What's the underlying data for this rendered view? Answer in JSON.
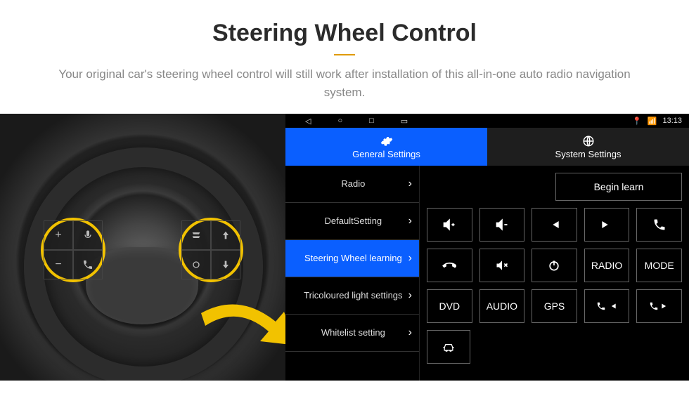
{
  "header": {
    "title": "Steering Wheel Control",
    "subtitle": "Your original car's steering wheel control will still work after installation of this all-in-one auto radio navigation system."
  },
  "statusbar": {
    "time": "13:13"
  },
  "tabs": {
    "general": "General Settings",
    "system": "System Settings"
  },
  "menu": {
    "radio": "Radio",
    "default": "DefaultSetting",
    "swl": "Steering Wheel learning",
    "tri": "Tricoloured light settings",
    "white": "Whitelist setting"
  },
  "actions": {
    "begin": "Begin learn"
  },
  "buttons": {
    "radio": "RADIO",
    "mode": "MODE",
    "dvd": "DVD",
    "audio": "AUDIO",
    "gps": "GPS"
  }
}
